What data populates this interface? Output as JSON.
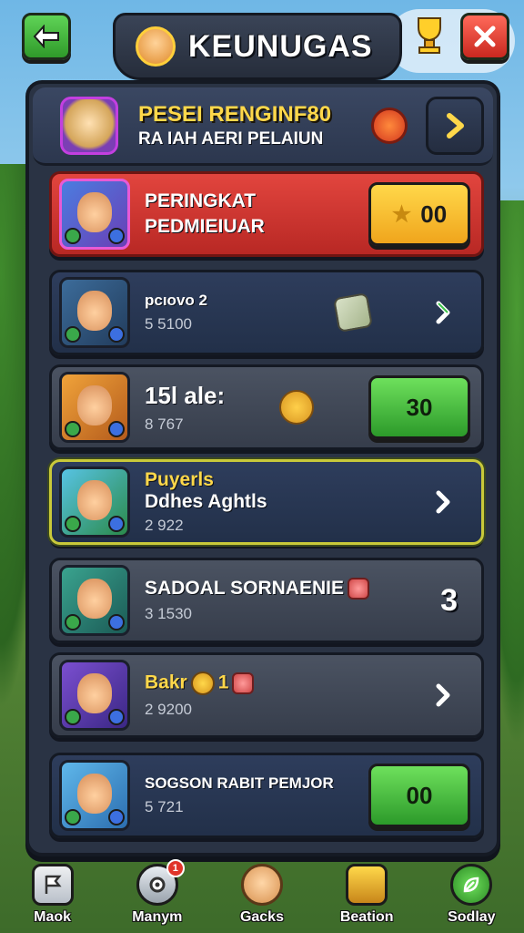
{
  "header": {
    "title": "KEUNUGAS"
  },
  "panel_header": {
    "line1": "PESEI RENGINF80",
    "line2": "RA IAH AERI PELAIUN"
  },
  "rows": [
    {
      "name_line1": "PERINGKAT",
      "name_line2": "PEDMIEIUAR",
      "action_value": "00"
    },
    {
      "name": "pcıovo  2",
      "sub": "5 5100"
    },
    {
      "name": "15l ale:",
      "sub": "8 767",
      "action_value": "30"
    },
    {
      "name_line1": "Puyerls",
      "name_line2": "Ddhes Aghtls",
      "sub": "2 922"
    },
    {
      "name": "SADOAL SORNAENIE",
      "sub": "3 1530",
      "rank": "3"
    },
    {
      "name": "Bakr",
      "name_suffix": "1",
      "sub": "2 9200"
    },
    {
      "name": "SOGSON RABIT PEMJOR",
      "sub": "5 721",
      "action_value": "00"
    }
  ],
  "bottom_nav": [
    {
      "label": "Maok"
    },
    {
      "label": "Manym",
      "badge": "1"
    },
    {
      "label": "Gacks"
    },
    {
      "label": "Beation"
    },
    {
      "label": "Sodlay"
    }
  ],
  "colors": {
    "highlight_row": "#e2453e",
    "accent_yellow": "#ffd84a",
    "accent_green": "#3cb634",
    "panel_bg": "#2a3344"
  },
  "icons": {
    "back": "arrow-left-icon",
    "close": "close-icon",
    "trophy": "trophy-icon",
    "next": "chevron-right-icon",
    "star": "star-icon"
  }
}
